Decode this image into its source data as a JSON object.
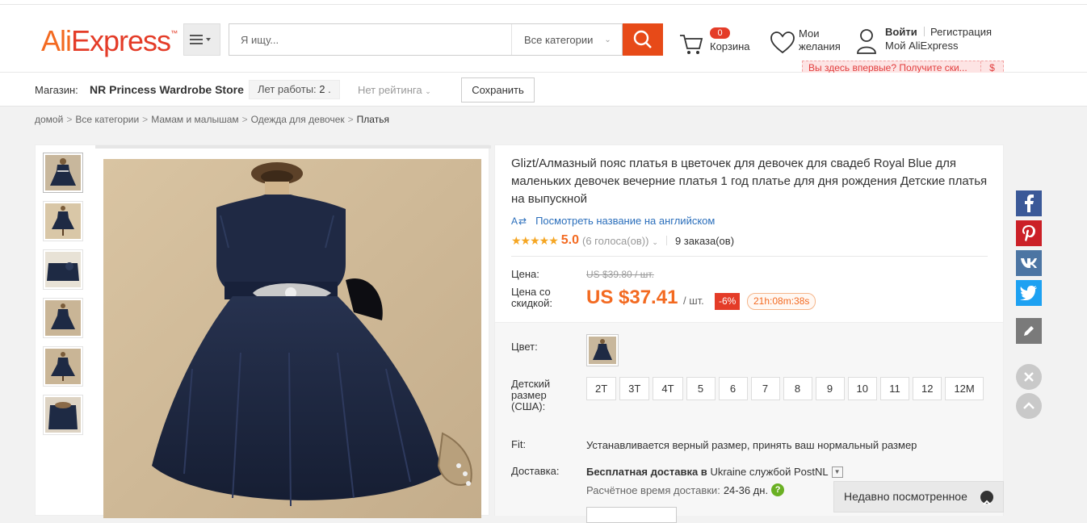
{
  "header": {
    "logo": {
      "ali": "Ali",
      "express": "Express",
      "tm": "™"
    },
    "search": {
      "placeholder": "Я ищу...",
      "category": "Все категории"
    },
    "cart": {
      "count": "0",
      "label": "Корзина"
    },
    "wishlist": {
      "line1": "Мои",
      "line2": "желания"
    },
    "account": {
      "login": "Войти",
      "register": "Регистрация",
      "my": "Мой AliExpress"
    },
    "promo": {
      "text": "Вы здесь впервые? Получите ски...",
      "dollar": "$"
    }
  },
  "store": {
    "label": "Магазин:",
    "name": "NR Princess Wardrobe Store",
    "years_label": "Лет работы:",
    "years_value": "2",
    "rating": "Нет рейтинга",
    "save": "Сохранить"
  },
  "breadcrumb": [
    "домой",
    "Все категории",
    "Мамам и малышам",
    "Одежда для девочек",
    "Платья"
  ],
  "product": {
    "title": "Glizt/Алмазный пояс платья в цветочек для девочек для свадеб Royal Blue для маленьких девочек вечерние платья 1 год платье для дня рождения Детские платья на выпускной",
    "translate": "Посмотреть название на английском",
    "stars": "★★★★★",
    "score": "5.0",
    "votes": "(6 голоса(ов))",
    "orders": "9 заказа(ов)",
    "price_label": "Цена:",
    "price_old": "US $39.80 / шт.",
    "sale_label": "Цена со скидкой:",
    "price_new": "US $37.41",
    "per_unit": "/ шт.",
    "discount": "-6%",
    "timer": "21h:08m:38s"
  },
  "options": {
    "color_label": "Цвет:",
    "size_label": "Детский размер (США):",
    "sizes": [
      "2T",
      "3T",
      "4T",
      "5",
      "6",
      "7",
      "8",
      "9",
      "10",
      "11",
      "12",
      "12M"
    ],
    "fit_label": "Fit:",
    "fit_text": "Устанавливается верный размер, принять ваш нормальный размер",
    "shipping_label": "Доставка:",
    "shipping_bold": "Бесплатная доставка в",
    "shipping_rest": "Ukraine службой PostNL",
    "ship_time_label": "Расчётное время доставки:",
    "ship_time_days": "24-36 дн."
  },
  "recent": {
    "label": "Недавно посмотренное"
  },
  "social": [
    "facebook-icon",
    "pinterest-icon",
    "vk-icon",
    "twitter-icon",
    "edit-icon"
  ],
  "colors": {
    "brand": "#f36a21",
    "search": "#e74a18",
    "facebook": "#3b5998",
    "pinterest": "#cb2027",
    "vk": "#4c75a3",
    "twitter": "#1da1f2",
    "dress": "#1e2a44"
  }
}
